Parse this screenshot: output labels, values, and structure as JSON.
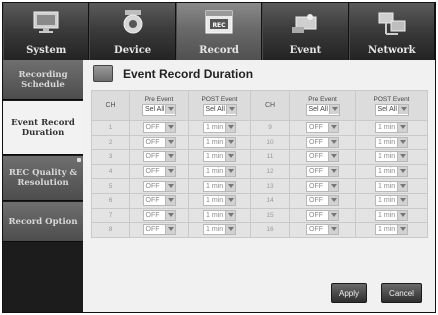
{
  "top_tabs": [
    {
      "label": "System",
      "icon": "monitor-icon",
      "active": false
    },
    {
      "label": "Device",
      "icon": "camera-icon",
      "active": false
    },
    {
      "label": "Record",
      "icon": "rec-icon",
      "active": true
    },
    {
      "label": "Event",
      "icon": "event-icon",
      "active": false
    },
    {
      "label": "Network",
      "icon": "network-icon",
      "active": false
    }
  ],
  "side_menu": [
    {
      "label": "Recording Schedule",
      "active": false
    },
    {
      "label": "Event Record Duration",
      "active": true
    },
    {
      "label": "REC Quality & Resolution",
      "active": false
    },
    {
      "label": "Record Option",
      "active": false
    }
  ],
  "rec_badge": "REC",
  "page_title": "Event Record Duration",
  "table": {
    "ch_header": "CH",
    "pre_event_header": "Pre Event",
    "post_event_header": "POST Event",
    "select_all": "Sel All",
    "left_rows": [
      {
        "ch": "1",
        "pre": "OFF",
        "post": "1 min"
      },
      {
        "ch": "2",
        "pre": "OFF",
        "post": "1 min"
      },
      {
        "ch": "3",
        "pre": "OFF",
        "post": "1 min"
      },
      {
        "ch": "4",
        "pre": "OFF",
        "post": "1 min"
      },
      {
        "ch": "5",
        "pre": "OFF",
        "post": "1 min"
      },
      {
        "ch": "6",
        "pre": "OFF",
        "post": "1 min"
      },
      {
        "ch": "7",
        "pre": "OFF",
        "post": "1 min"
      },
      {
        "ch": "8",
        "pre": "OFF",
        "post": "1 min"
      }
    ],
    "right_rows": [
      {
        "ch": "9",
        "pre": "OFF",
        "post": "1 min"
      },
      {
        "ch": "10",
        "pre": "OFF",
        "post": "1 min"
      },
      {
        "ch": "11",
        "pre": "OFF",
        "post": "1 min"
      },
      {
        "ch": "12",
        "pre": "OFF",
        "post": "1 min"
      },
      {
        "ch": "13",
        "pre": "OFF",
        "post": "1 min"
      },
      {
        "ch": "14",
        "pre": "OFF",
        "post": "1 min"
      },
      {
        "ch": "15",
        "pre": "OFF",
        "post": "1 min"
      },
      {
        "ch": "16",
        "pre": "OFF",
        "post": "1 min"
      }
    ]
  },
  "buttons": {
    "apply": "Apply",
    "cancel": "Cancel"
  }
}
